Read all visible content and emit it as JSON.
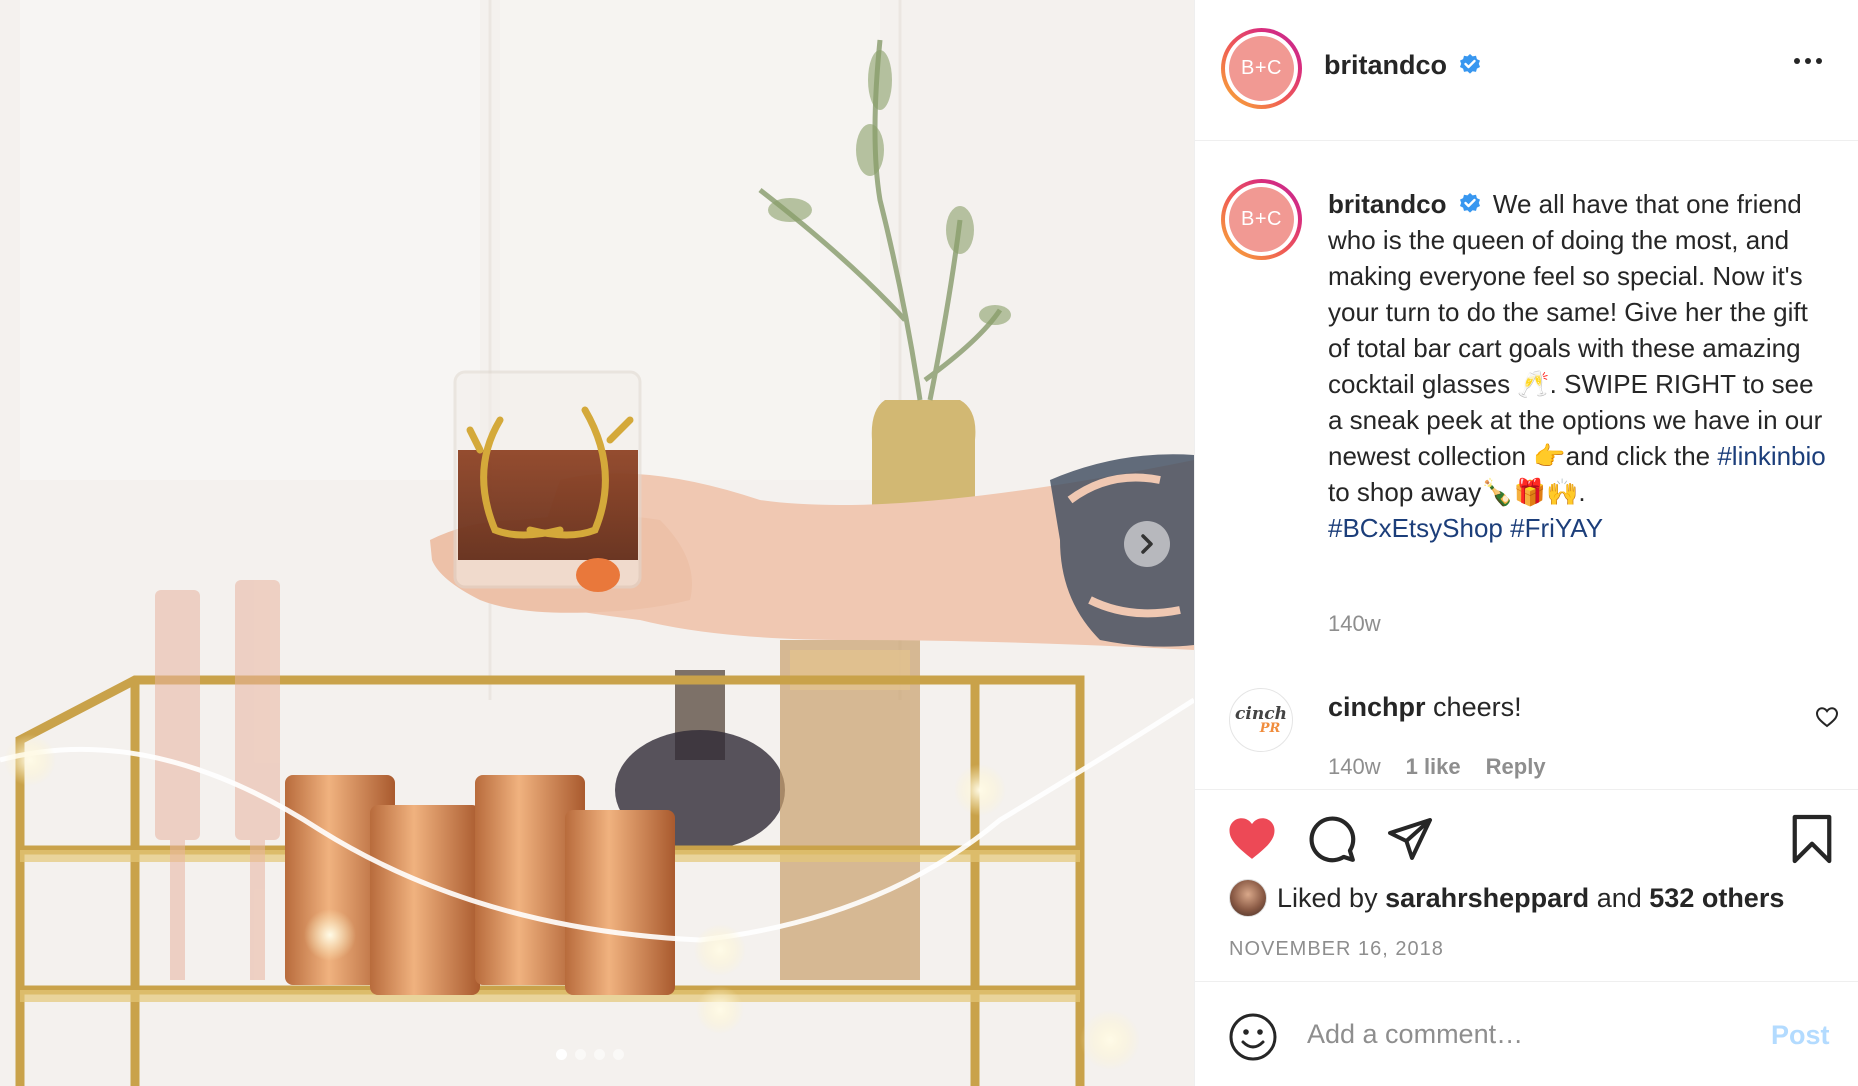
{
  "post": {
    "media": {
      "alt": "",
      "carousel_total": 4,
      "carousel_active": 1,
      "next_icon": "chevron-right-icon"
    },
    "author": {
      "avatar_text": "B+C",
      "username": "britandco",
      "verified": true,
      "verified_color": "#3897f0"
    },
    "caption": {
      "username": "britandco",
      "text_1": "We all have that one friend who is the queen of doing the most, and making everyone feel so special. Now it's your turn to do the same! Give her the gift of total bar cart goals with these amazing cocktail glasses 🥂. SWIPE RIGHT to see a sneak peek at the options we have in our newest collection 👉and click the ",
      "hashtag_1": "#linkinbio",
      "text_2": " to shop away🍾🎁🙌.",
      "hashtag_2": "#BCxEtsyShop",
      "hashtag_3": "#FriYAY",
      "time": "140w"
    },
    "comments": [
      {
        "avatar_text_1": "cinch",
        "avatar_text_2": "PR",
        "username": "cinchpr",
        "text": "cheers!",
        "time": "140w",
        "likes": "1 like",
        "reply_label": "Reply"
      }
    ],
    "actions": {
      "like_icon": "heart-filled-icon",
      "like_color": "#ed4956",
      "comment_icon": "comment-icon",
      "share_icon": "paper-plane-icon",
      "save_icon": "bookmark-icon"
    },
    "likes": {
      "prefix": "Liked by",
      "user": "sarahrsheppard",
      "middle": "and",
      "others": "532 others"
    },
    "date": "NOVEMBER 16, 2018",
    "add_comment": {
      "emoji_icon": "smiley-icon",
      "placeholder": "Add a comment…",
      "post_label": "Post",
      "post_color": "#b3dbff"
    }
  }
}
